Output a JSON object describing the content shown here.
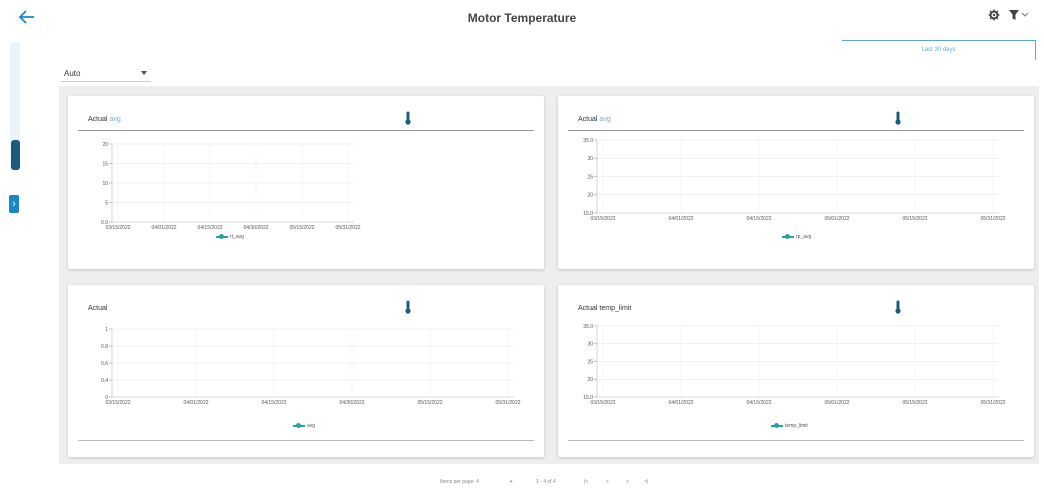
{
  "header": {
    "title": "Motor Temperature",
    "back_icon": "arrow-left-icon",
    "settings_icon": "gear-icon",
    "filter_icon": "filter-icon"
  },
  "toolbar": {
    "link_text": "Last 30 days",
    "select_value": "Auto"
  },
  "colors": {
    "accent": "#1a86c8",
    "series": "#2a9fa3",
    "panel_bg": "#eeeeee"
  },
  "cards": [
    {
      "title": "Actual",
      "subtitle": "avg",
      "icon": "thermometer-icon"
    },
    {
      "title": "Actual",
      "subtitle": "avg",
      "icon": "thermometer-icon"
    },
    {
      "title": "Actual",
      "subtitle": "",
      "icon": "thermometer-icon"
    },
    {
      "title": "Actual temp_limit",
      "subtitle": "",
      "icon": "thermometer-icon"
    }
  ],
  "chart_data": [
    {
      "type": "line",
      "title": "",
      "x": [
        "03/15/2022",
        "04/01/2022",
        "04/15/2022",
        "04/30/2022",
        "05/15/2022",
        "05/31/2022"
      ],
      "yticks": [
        "20",
        "15",
        "10",
        "5",
        "0.0"
      ],
      "ylim": [
        0,
        20
      ],
      "series": [
        {
          "name": "rt_avg",
          "values": []
        }
      ],
      "grid": true,
      "legend": "bottom"
    },
    {
      "type": "line",
      "title": "",
      "x": [
        "03/15/2022",
        "04/01/2022",
        "04/15/2022",
        "05/01/2022",
        "05/15/2022",
        "05/31/2022"
      ],
      "yticks": [
        "35.0",
        "30",
        "25",
        "20",
        "15.0"
      ],
      "ylim": [
        15,
        35
      ],
      "series": [
        {
          "name": "rp_avg",
          "values": []
        }
      ],
      "grid": true,
      "legend": "bottom"
    },
    {
      "type": "line",
      "title": "",
      "x": [
        "03/15/2022",
        "04/01/2022",
        "04/15/2022",
        "04/30/2022",
        "05/15/2022",
        "05/31/2022"
      ],
      "yticks": [
        "1",
        "0.8",
        "0.6",
        "0.4",
        "0"
      ],
      "ylim": [
        0,
        1
      ],
      "series": [
        {
          "name": "avg",
          "values": []
        }
      ],
      "grid": true,
      "legend": "bottom"
    },
    {
      "type": "line",
      "title": "",
      "x": [
        "03/15/2022",
        "04/01/2022",
        "04/15/2022",
        "05/01/2022",
        "05/15/2022",
        "05/31/2022"
      ],
      "yticks": [
        "35.0",
        "30",
        "25",
        "20",
        "15.0"
      ],
      "ylim": [
        15,
        35
      ],
      "series": [
        {
          "name": "temp_limit",
          "values": []
        }
      ],
      "grid": true,
      "legend": "bottom"
    }
  ],
  "pager": {
    "items_per_page": "Items per page: 4",
    "range": "1 - 4 of 4",
    "first": "|<",
    "prev": "<",
    "next": ">",
    "last": ">|"
  }
}
